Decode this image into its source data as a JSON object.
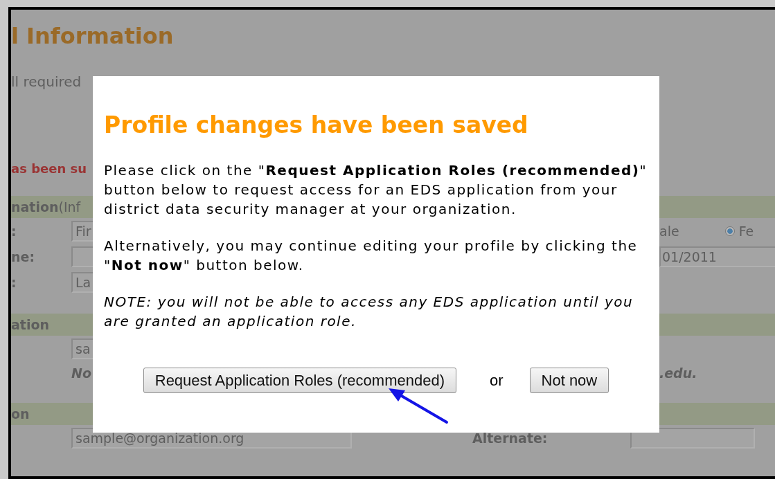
{
  "page": {
    "heading": "l Information",
    "instructions": "ll required",
    "status_message": "as been su",
    "sections": [
      {
        "title": "nation",
        "subtitle": "(Inf",
        "rows": [
          {
            "label": ":",
            "value": "Fir",
            "right": [
              {
                "kind": "text",
                "text": "ale"
              },
              {
                "kind": "radio",
                "label": "Fe",
                "selected": true
              }
            ]
          },
          {
            "label": "ne:",
            "right": [
              {
                "kind": "field",
                "value": "01/2011"
              }
            ]
          },
          {
            "label": ":",
            "value": "La"
          }
        ]
      },
      {
        "title": "ation",
        "rows": [
          {
            "value": "sa"
          },
          {
            "note": "No",
            "right": [
              {
                "kind": "note",
                "text": ".edu."
              }
            ]
          }
        ]
      },
      {
        "title": "on",
        "rows": [
          {
            "value": "sample@organization.org",
            "right": [
              {
                "kind": "label",
                "text": "Alternate:"
              },
              {
                "kind": "field"
              }
            ]
          }
        ]
      }
    ]
  },
  "dialog": {
    "title": "Profile changes have been saved",
    "paragraphs": [
      {
        "kind": "plain",
        "text": "Please click on the \"**Request Application Roles (recommended)**\" button below to request access for an EDS application from your district data security manager at your organization."
      },
      {
        "kind": "plain",
        "text": "Alternatively, you may continue editing your profile by clicking the \"**Not now**\" button below."
      },
      {
        "kind": "note",
        "text": "NOTE: you will not be able to access any EDS application until you are granted an application role."
      }
    ],
    "primary_button": "Request Application Roles (recommended)",
    "separator": "or",
    "secondary_button": "Not now"
  }
}
